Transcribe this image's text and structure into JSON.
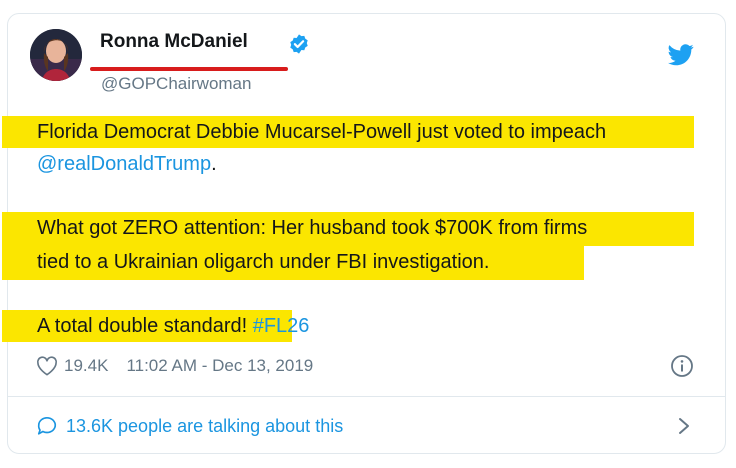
{
  "author": {
    "name": "Ronna McDaniel",
    "handle": "@GOPChairwoman"
  },
  "tweet": {
    "line1": "Florida Democrat Debbie Mucarsel-Powell just voted to impeach",
    "mention": "@realDonaldTrump",
    "mention_suffix": ".",
    "line3": "What got ZERO attention: Her husband took $700K from firms",
    "line4": "tied to a Ukrainian oligarch under FBI investigation.",
    "line5_text": "A total double standard! ",
    "hashtag": "#FL26"
  },
  "meta": {
    "likes": "19.4K",
    "timestamp": "11:02 AM - Dec 13, 2019"
  },
  "footer": {
    "talking": "13.6K people are talking about this"
  },
  "colors": {
    "highlight": "#fbe600",
    "link": "#1b95e0",
    "underline": "#d81c1c",
    "verified": "#1da1f2"
  },
  "icons": [
    "verified-badge-icon",
    "twitter-bird-icon",
    "heart-icon",
    "info-icon",
    "speech-bubble-icon",
    "chevron-right-icon"
  ]
}
